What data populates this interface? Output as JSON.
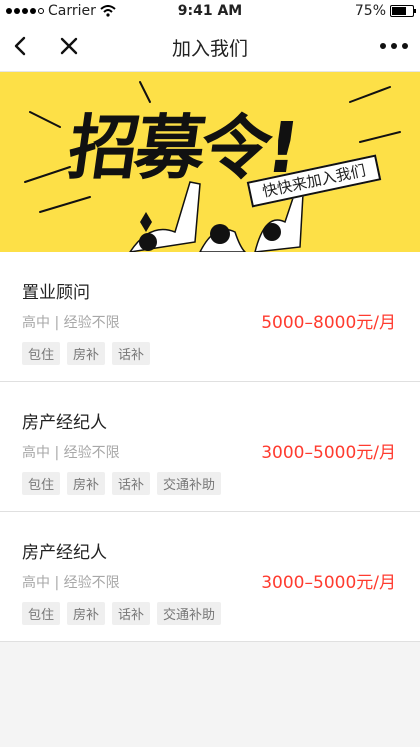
{
  "status_bar": {
    "carrier": "Carrier",
    "time": "9:41 AM",
    "battery": "75%"
  },
  "nav": {
    "title": "加入我们",
    "back_icon": "chevron-left-icon",
    "close_icon": "close-icon",
    "more_icon": "more-dots-icon"
  },
  "banner": {
    "title": "招募令!",
    "subtitle": "快快来加入我们"
  },
  "jobs": [
    {
      "title": "置业顾问",
      "requirements": "高中 | 经验不限",
      "salary": "5000–8000元/月",
      "tags": [
        "包住",
        "房补",
        "话补"
      ]
    },
    {
      "title": "房产经纪人",
      "requirements": "高中 | 经验不限",
      "salary": "3000–5000元/月",
      "tags": [
        "包住",
        "房补",
        "话补",
        "交通补助"
      ]
    },
    {
      "title": "房产经纪人",
      "requirements": "高中 | 经验不限",
      "salary": "3000–5000元/月",
      "tags": [
        "包住",
        "房补",
        "话补",
        "交通补助"
      ]
    }
  ],
  "colors": {
    "accent": "#ff3b2f",
    "banner": "#fde047"
  }
}
